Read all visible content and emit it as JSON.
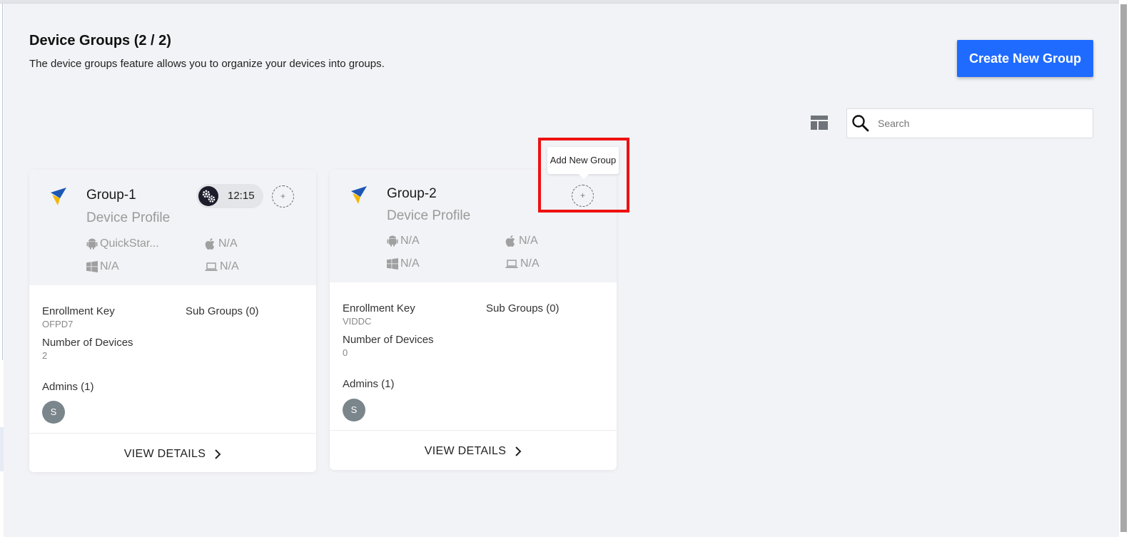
{
  "page": {
    "title": "Device Groups (2 / 2)",
    "subtitle": "The device groups feature allows you to organize your devices into groups."
  },
  "toolbar": {
    "create_label": "Create New Group",
    "search_placeholder": "Search",
    "layout_icon": "layout-grid-icon",
    "search_icon": "search-icon"
  },
  "colors": {
    "primary": "#1f6bff",
    "highlight": "#ee1111",
    "avatar": "#7b858c"
  },
  "groups": [
    {
      "name": "Group-1",
      "profile_label": "Device Profile",
      "android": "QuickStar...",
      "ios": "N/A",
      "windows": "N/A",
      "other": "N/A",
      "schedule_time": "12:15",
      "add_label": "+",
      "enrollment_label": "Enrollment Key",
      "enrollment_key": "OFPD7",
      "subgroups_label": "Sub Groups (0)",
      "devices_label": "Number of Devices",
      "devices_count": "2",
      "admins_label": "Admins (1)",
      "admin_initial": "S",
      "view_label": "VIEW DETAILS"
    },
    {
      "name": "Group-2",
      "profile_label": "Device Profile",
      "android": "N/A",
      "ios": "N/A",
      "windows": "N/A",
      "other": "N/A",
      "add_label": "+",
      "enrollment_label": "Enrollment Key",
      "enrollment_key": "VIDDC",
      "subgroups_label": "Sub Groups (0)",
      "devices_label": "Number of Devices",
      "devices_count": "0",
      "admins_label": "Admins (1)",
      "admin_initial": "S",
      "view_label": "VIEW DETAILS"
    }
  ],
  "tooltip": {
    "label": "Add New Group"
  }
}
